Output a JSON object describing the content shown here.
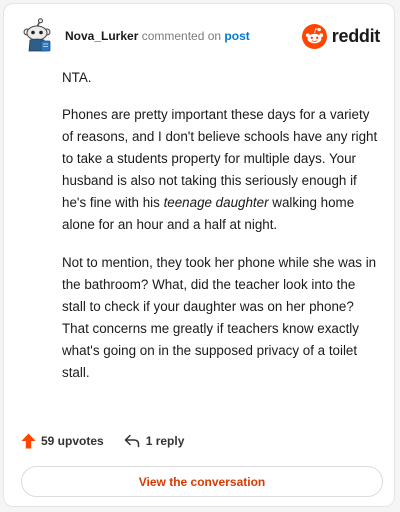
{
  "comment": {
    "username": "Nova_Lurker",
    "action_text": " commented on ",
    "post_link_text": "post",
    "paragraphs": {
      "p1": "NTA.",
      "p2_a": "Phones are pretty important these days for a variety of reasons, and I don't believe schools have any right to take a students property for multiple days. Your husband is also not taking this seriously enough if he's fine with his ",
      "p2_em": "teenage daughter",
      "p2_b": " walking home alone for an hour and a half at night.",
      "p3": "Not to mention, they took her phone while she was in the bathroom? What, did the teacher look into the stall to check if your daughter was on her phone? That concerns me greatly if teachers know exactly what's going on in the supposed privacy of a toilet stall."
    }
  },
  "brand": {
    "name": "reddit",
    "icon": "reddit-snoo-icon",
    "color": "#ff4500"
  },
  "footer": {
    "upvotes_label": "59 upvotes",
    "upvote_icon": "upvote-arrow-icon",
    "upvote_color": "#ff4500",
    "replies_label": "1 reply",
    "reply_icon": "reply-arrow-icon"
  },
  "cta": {
    "label": "View the conversation",
    "color": "#d93a00"
  }
}
